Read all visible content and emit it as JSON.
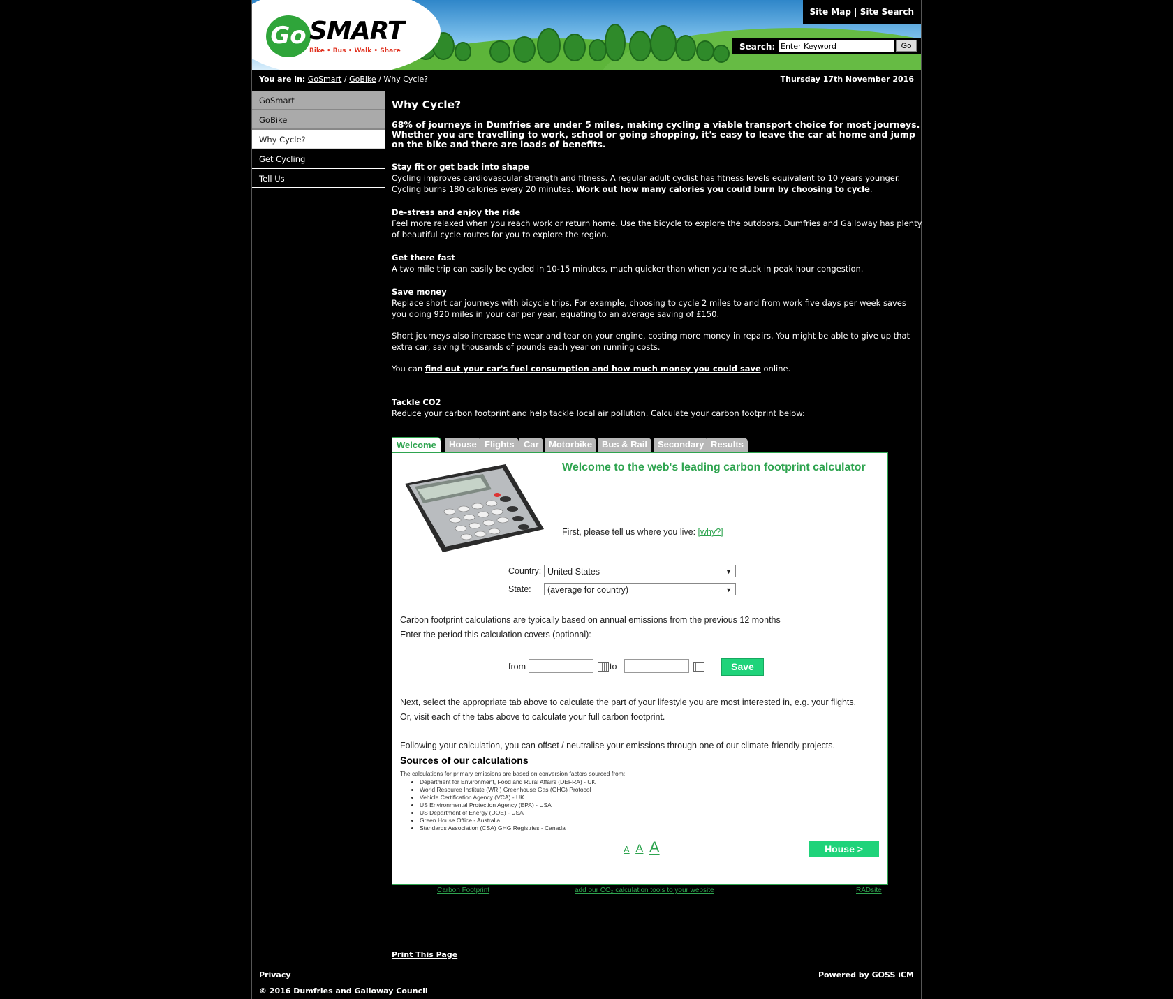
{
  "header": {
    "logo_go": "Go",
    "logo_smart": "SMART",
    "logo_tagline": "Bike • Bus • Walk • Share",
    "sitemap_link": "Site Map",
    "separator": "|",
    "sitesearch_link": "Site Search",
    "search_label": "Search:",
    "search_value": "Enter Keyword",
    "search_go": "Go"
  },
  "breadcrumb": {
    "prefix": "You are in:",
    "items": [
      "GoSmart",
      "GoBike"
    ],
    "sep": "/",
    "current": "Why Cycle?"
  },
  "date": "Thursday 17th November 2016",
  "nav": {
    "items": [
      "GoSmart",
      "GoBike",
      "Why Cycle?",
      "Get Cycling",
      "Tell Us"
    ]
  },
  "article": {
    "title": "Why Cycle?",
    "intro": "68% of journeys in Dumfries are under 5 miles, making cycling a viable transport choice for most journeys. Whether you are travelling to work, school or going shopping, it's easy to leave the car at home and jump on the bike and there are loads of benefits.",
    "s1_title": "Stay fit or get back into shape",
    "s1_text": "Cycling improves cardiovascular strength and fitness. A regular adult cyclist has fitness levels equivalent to 10 years younger. Cycling burns 180 calories every 20 minutes. ",
    "s1_link": "Work out how many calories you could burn by choosing to cycle",
    "s2_title": "De-stress and enjoy the ride",
    "s2_text": "Feel more relaxed when you reach work or return home. Use the bicycle to explore the outdoors. Dumfries and Galloway has plenty of beautiful cycle routes for you to explore the region.",
    "s3_title": "Get there fast",
    "s3_text": "A two mile trip can easily be cycled in 10-15 minutes, much quicker than when you're stuck in peak hour congestion.",
    "s4_title": "Save money",
    "s4_text": "Replace short car journeys with bicycle trips. For example, choosing to cycle 2 miles to and from work five days per week saves you doing 920 miles in your car per year, equating to an average saving of £150.",
    "s4_text2": "Short journeys also increase the wear and tear on your engine, costing more money in repairs. You might be able to give up that extra car, saving thousands of pounds each year on running costs.",
    "s4_pre": "You can ",
    "s4_link": "find out your car's fuel consumption and how much money you could save",
    "s4_post": " online.",
    "s5_title": "Tackle CO2",
    "s5_text": "Reduce your carbon footprint and help tackle local air pollution.  Calculate your carbon footprint below:"
  },
  "calculator": {
    "tabs": [
      "Welcome",
      "House",
      "Flights",
      "Car",
      "Motorbike",
      "Bus & Rail",
      "Secondary",
      "Results"
    ],
    "welcome_title": "Welcome to the web's leading carbon footprint calculator",
    "where_text": "First, please tell us where you live: ",
    "why_link": "[why?]",
    "country_label": "Country:",
    "country_value": "United States",
    "state_label": "State:",
    "state_value": "(average for country)",
    "period_text1": "Carbon footprint calculations are typically based on annual emissions from the previous 12 months",
    "period_text2": "Enter the period this calculation covers (optional):",
    "from_label": "from",
    "to_label": "to",
    "save_button": "Save",
    "next_text1": "Next, select the appropriate tab above to calculate the part of your lifestyle you are most interested in, e.g. your flights.",
    "next_text2": "Or, visit each of the tabs above to calculate your full carbon footprint.",
    "offset_text": "Following your calculation, you can offset / neutralise your emissions through one of our climate-friendly projects.",
    "sources_title": "Sources of our calculations",
    "sources_intro": "The calculations for primary emissions are based on conversion factors sourced from:",
    "sources": [
      "Department for Environment, Food and Rural Affairs (DEFRA) - UK",
      "World Resource Institute (WRI) Greenhouse Gas (GHG) Protocol",
      "Vehicle Certification Agency (VCA) - UK",
      "US Environmental Protection Agency (EPA) - USA",
      "US Department of Energy (DOE) - USA",
      "Green House Office - Australia",
      "Standards Association (CSA) GHG Registries - Canada"
    ],
    "font_small": "A",
    "font_medium": "A",
    "font_large": "A",
    "house_button": "House >",
    "link_footprint": "Carbon Footprint",
    "link_tools": "add our CO₂ calculation tools to your website",
    "link_radsite": "RADsite",
    "accent_color": "#2ea44f",
    "button_color": "#1fd37a"
  },
  "footer": {
    "print": "Print This Page",
    "privacy": "Privacy",
    "powered": "Powered by GOSS iCM",
    "copyright": "© 2016 Dumfries and Galloway Council"
  }
}
